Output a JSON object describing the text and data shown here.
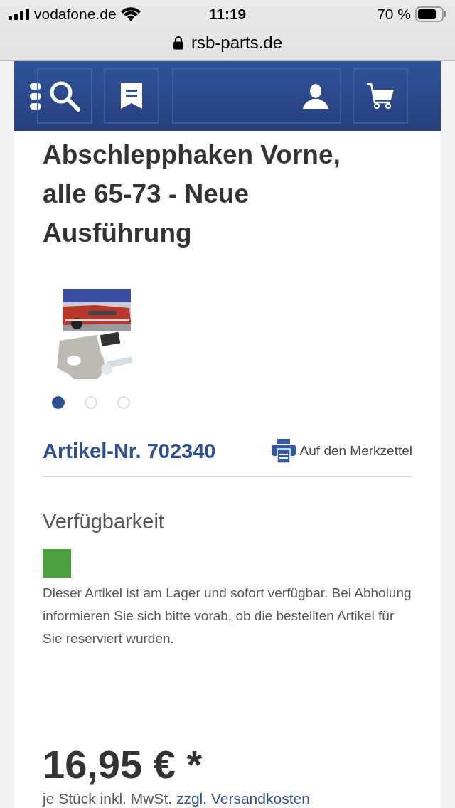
{
  "status_bar": {
    "carrier": "vodafone.de",
    "time": "11:19",
    "battery": "70 %"
  },
  "address_bar": {
    "url": "rsb-parts.de"
  },
  "product": {
    "title": "Abschlepphaken Vorne, alle 65-73 - Neue Ausführung",
    "gallery": [
      {
        "selected": true
      },
      {
        "selected": false
      },
      {
        "selected": false
      }
    ],
    "article_number": "Artikel-Nr. 702340",
    "wishlist": "Auf den Merkzettel",
    "availability_heading": "Verfügbarkeit",
    "in_stock": true,
    "availability_text": "Dieser Artikel ist am Lager und sofort verfügbar. Bei Abholung informieren Sie sich bitte vorab, ob die bestellten Artikel für Sie reserviert wurden.",
    "price": "16,95 € *",
    "price_note": "je Stück inkl. MwSt.",
    "shipping_link": "zzgl. Versandkosten"
  }
}
